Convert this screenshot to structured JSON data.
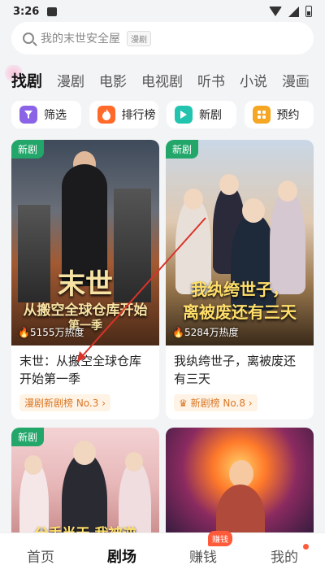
{
  "status_bar": {
    "time": "3:26"
  },
  "search": {
    "placeholder": "我的末世安全屋",
    "tag": "漫剧"
  },
  "category_tabs": [
    "找剧",
    "漫剧",
    "电影",
    "电视剧",
    "听书",
    "小说",
    "漫画"
  ],
  "chips": [
    {
      "label": "筛选",
      "icon": "filter-icon",
      "color": "#8a63e6"
    },
    {
      "label": "排行榜",
      "icon": "flame-icon",
      "color": "#ff6a2a"
    },
    {
      "label": "新剧",
      "icon": "play-icon",
      "color": "#22c4b0"
    },
    {
      "label": "预约",
      "icon": "calendar-icon",
      "color": "#f5a623"
    }
  ],
  "cards": [
    {
      "badge": "新剧",
      "cover_text_top": "末世",
      "cover_text_bottom": "从搬空全球仓库开始",
      "cover_text_small": "第一季",
      "heat": "5155万热度",
      "title": "末世：从搬空全球仓库开始第一季",
      "rank": "漫剧新剧榜 No.3"
    },
    {
      "badge": "新剧",
      "cover_text_top": "我纨绔世子，",
      "cover_text_bottom": "离被废还有三天",
      "heat": "5284万热度",
      "title": "我纨绔世子，离被废还有三天",
      "rank": "新剧榜 No.8"
    },
    {
      "badge": "新剧",
      "cover_text_bottom": "分手当天  我被逆"
    },
    {}
  ],
  "bottom_nav": [
    {
      "label": "首页"
    },
    {
      "label": "剧场"
    },
    {
      "label": "赚钱",
      "badge": "赚钱"
    },
    {
      "label": "我的"
    }
  ],
  "colors": {
    "accent_green": "#22a66a",
    "rank_orange": "#d97724",
    "badge_red": "#ff5a3a"
  }
}
